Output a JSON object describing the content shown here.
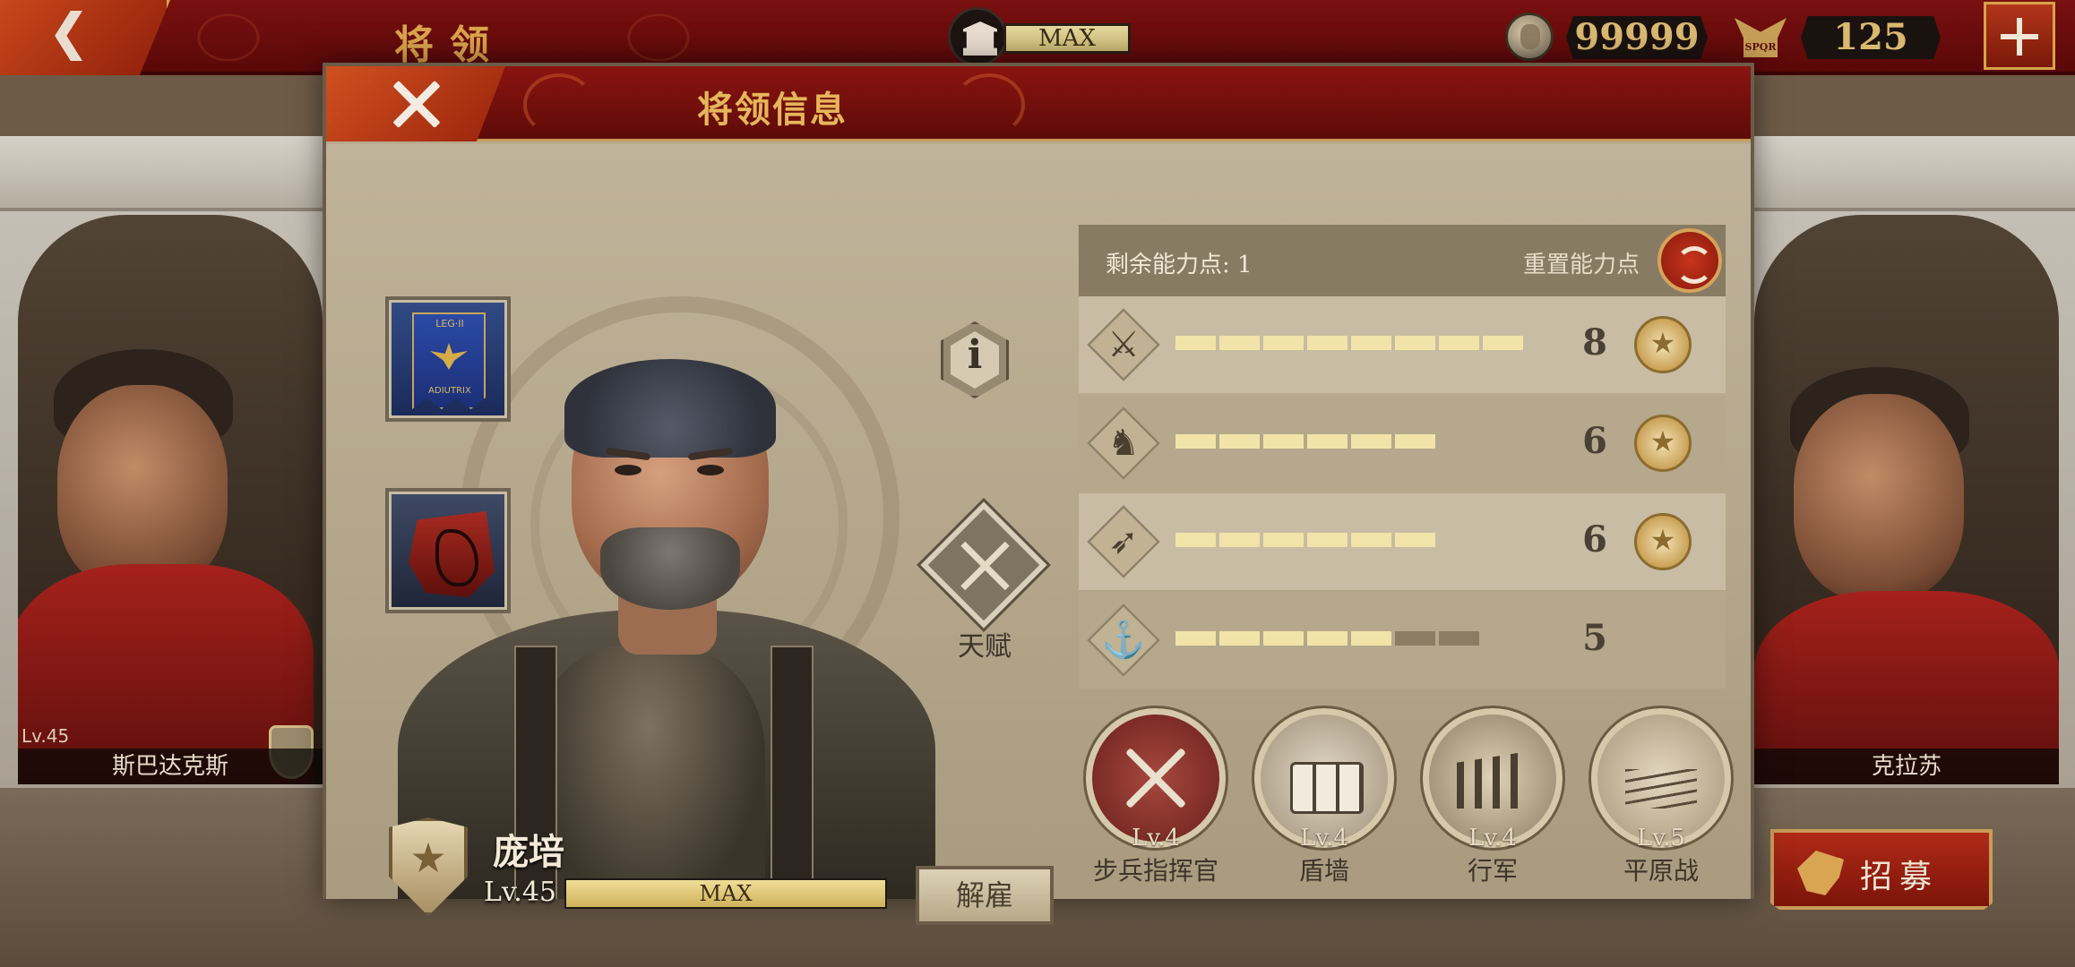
{
  "topbar": {
    "title": "将领",
    "building_status": "MAX",
    "gold": "99999",
    "spqr_icon_text": "SPQR",
    "spqr_amount": "125"
  },
  "background": {
    "left_general": {
      "name": "斯巴达克斯",
      "level": "Lv.45"
    },
    "right_general": {
      "name": "克拉苏"
    },
    "recruit_label": "招募"
  },
  "dialog": {
    "title": "将领信息",
    "items": {
      "banner_text_top": "LEG·II",
      "banner_text_bottom": "ADIUTRIX"
    },
    "info_glyph": "i",
    "talent_label": "天赋",
    "hero": {
      "name": "庞培",
      "level": "Lv.45",
      "exp_label": "MAX",
      "exp_fraction": 1.0
    },
    "dismiss_label": "解雇",
    "stats": {
      "remaining_points": "剩余能力点: 1",
      "reset_label": "重置能力点",
      "rows": [
        {
          "icon": "sword-icon",
          "glyph": "⚔",
          "value": "8",
          "filled": 8,
          "max": 8,
          "medal": true
        },
        {
          "icon": "horse-icon",
          "glyph": "♞",
          "value": "6",
          "filled": 6,
          "max": 6,
          "medal": true
        },
        {
          "icon": "bow-icon",
          "glyph": "➶",
          "value": "6",
          "filled": 6,
          "max": 6,
          "medal": true
        },
        {
          "icon": "anchor-icon",
          "glyph": "⚓",
          "value": "5",
          "filled": 5,
          "max": 7,
          "medal": false
        }
      ]
    },
    "skills": [
      {
        "level": "Lv.4",
        "name": "步兵指挥官"
      },
      {
        "level": "Lv.4",
        "name": "盾墙"
      },
      {
        "level": "Lv.4",
        "name": "行军"
      },
      {
        "level": "Lv.5",
        "name": "平原战"
      }
    ]
  },
  "colors": {
    "header_red": "#7a1010",
    "gold_text": "#e5b65a",
    "bar_fill": "#f2e3a8",
    "bar_empty": "#8a7d64"
  }
}
